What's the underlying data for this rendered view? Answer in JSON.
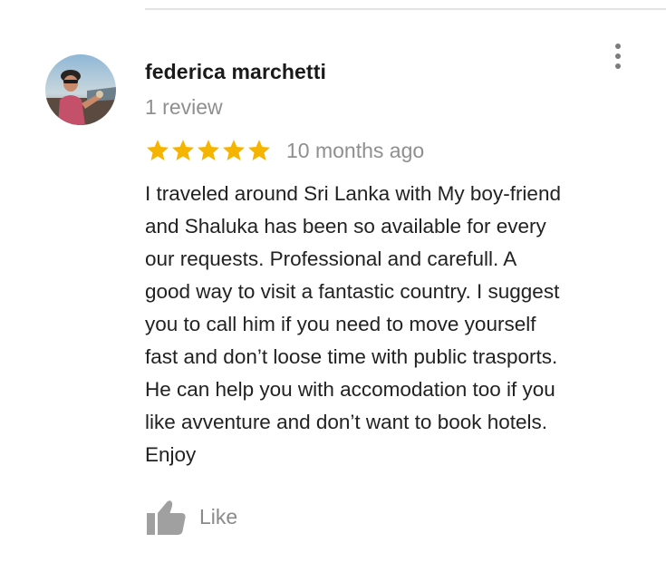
{
  "review": {
    "author_name": "federica marchetti",
    "review_count": "1 review",
    "rating": 5,
    "rating_max": 5,
    "time_ago": "10 months ago",
    "text_lines": [
      "I traveled around Sri Lanka with My boy-friend",
      "and Shaluka has been so available for every",
      "our requests. Professional and carefull. A",
      "good way to visit a fantastic country. I suggest",
      "you to call him if you need to move yourself",
      "fast and don’t loose time with public trasports.",
      "He can help you with accomodation too if you",
      "like avventure and don’t want to book hotels.",
      "Enjoy"
    ],
    "like_label": "Like"
  },
  "icons": {
    "more": "more-vertical-icon",
    "star": "star-icon",
    "like": "thumbs-up-icon"
  },
  "colors": {
    "star": "#f4b400",
    "author_text": "#1a1a1a",
    "secondary_text": "#8f8f8f",
    "body_text": "#222222",
    "icon_gray": "#a0a0a0",
    "divider": "#e3e3e3"
  }
}
